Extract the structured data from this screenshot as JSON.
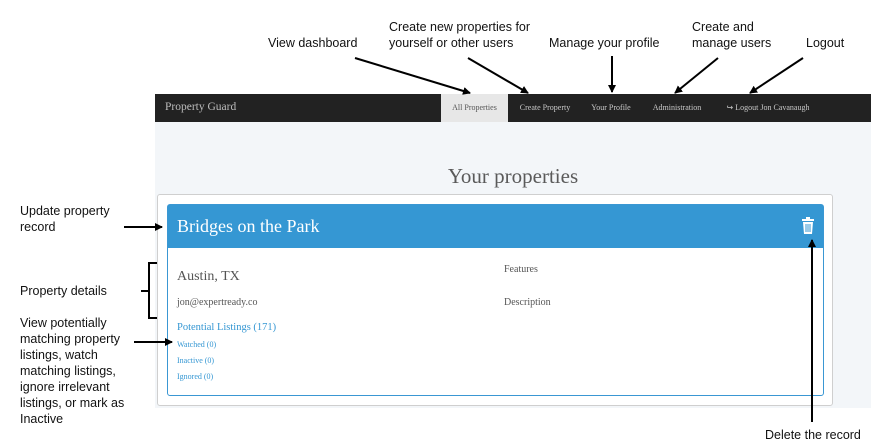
{
  "annotations": {
    "view_dashboard": "View dashboard",
    "create_properties": "Create new properties for yourself or other users",
    "manage_profile": "Manage your profile",
    "create_manage_users": "Create and manage users",
    "logout": "Logout",
    "update_record": "Update property record",
    "property_details": "Property details",
    "view_listings": "View potentially matching property listings, watch matching listings, ignore irrelevant listings, or mark as Inactive",
    "delete_record": "Delete the record"
  },
  "navbar": {
    "brand": "Property Guard",
    "items": [
      {
        "label": "All Properties",
        "active": true
      },
      {
        "label": "Create Property"
      },
      {
        "label": "Your Profile"
      },
      {
        "label": "Administration"
      },
      {
        "label": "Logout Jon Cavanaugh",
        "icon": "logout-icon"
      }
    ]
  },
  "main": {
    "title": "Your properties",
    "property": {
      "name": "Bridges on the Park",
      "location": "Austin, TX",
      "email": "jon@expertready.co",
      "features_label": "Features",
      "description_label": "Description",
      "potential_listings": "Potential Listings (171)",
      "watched": "Watched (0)",
      "inactive": "Inactive (0)",
      "ignored": "Ignored (0)",
      "delete_icon": "trash-icon"
    }
  },
  "colors": {
    "navbar_bg": "#222222",
    "card_header": "#3597d3",
    "link": "#3597d3",
    "page_bg": "#f3f6f9"
  }
}
